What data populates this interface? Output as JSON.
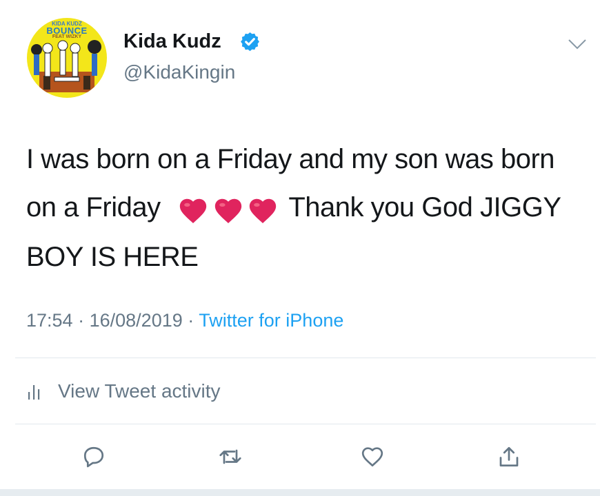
{
  "user": {
    "display_name": "Kida Kudz",
    "handle": "@KidaKingin",
    "avatar_text": [
      "KIDA KUDZ",
      "BOUNCE",
      "FEAT WIZKY"
    ]
  },
  "tweet": {
    "text_before": "I was born on a Friday and my son was born on a Friday",
    "emoji": [
      "red-heart-icon",
      "red-heart-icon",
      "red-heart-icon"
    ],
    "text_after": "Thank you God JIGGY BOY IS HERE",
    "time": "17:54",
    "date": "16/08/2019",
    "separator": "·",
    "source": "Twitter for iPhone"
  },
  "activity": {
    "label": "View Tweet activity"
  },
  "actions": [
    "reply-icon",
    "retweet-icon",
    "like-icon",
    "share-icon"
  ],
  "colors": {
    "text": "#14171a",
    "secondary": "#657786",
    "link": "#1da1f2",
    "heart": "#e0245e"
  }
}
